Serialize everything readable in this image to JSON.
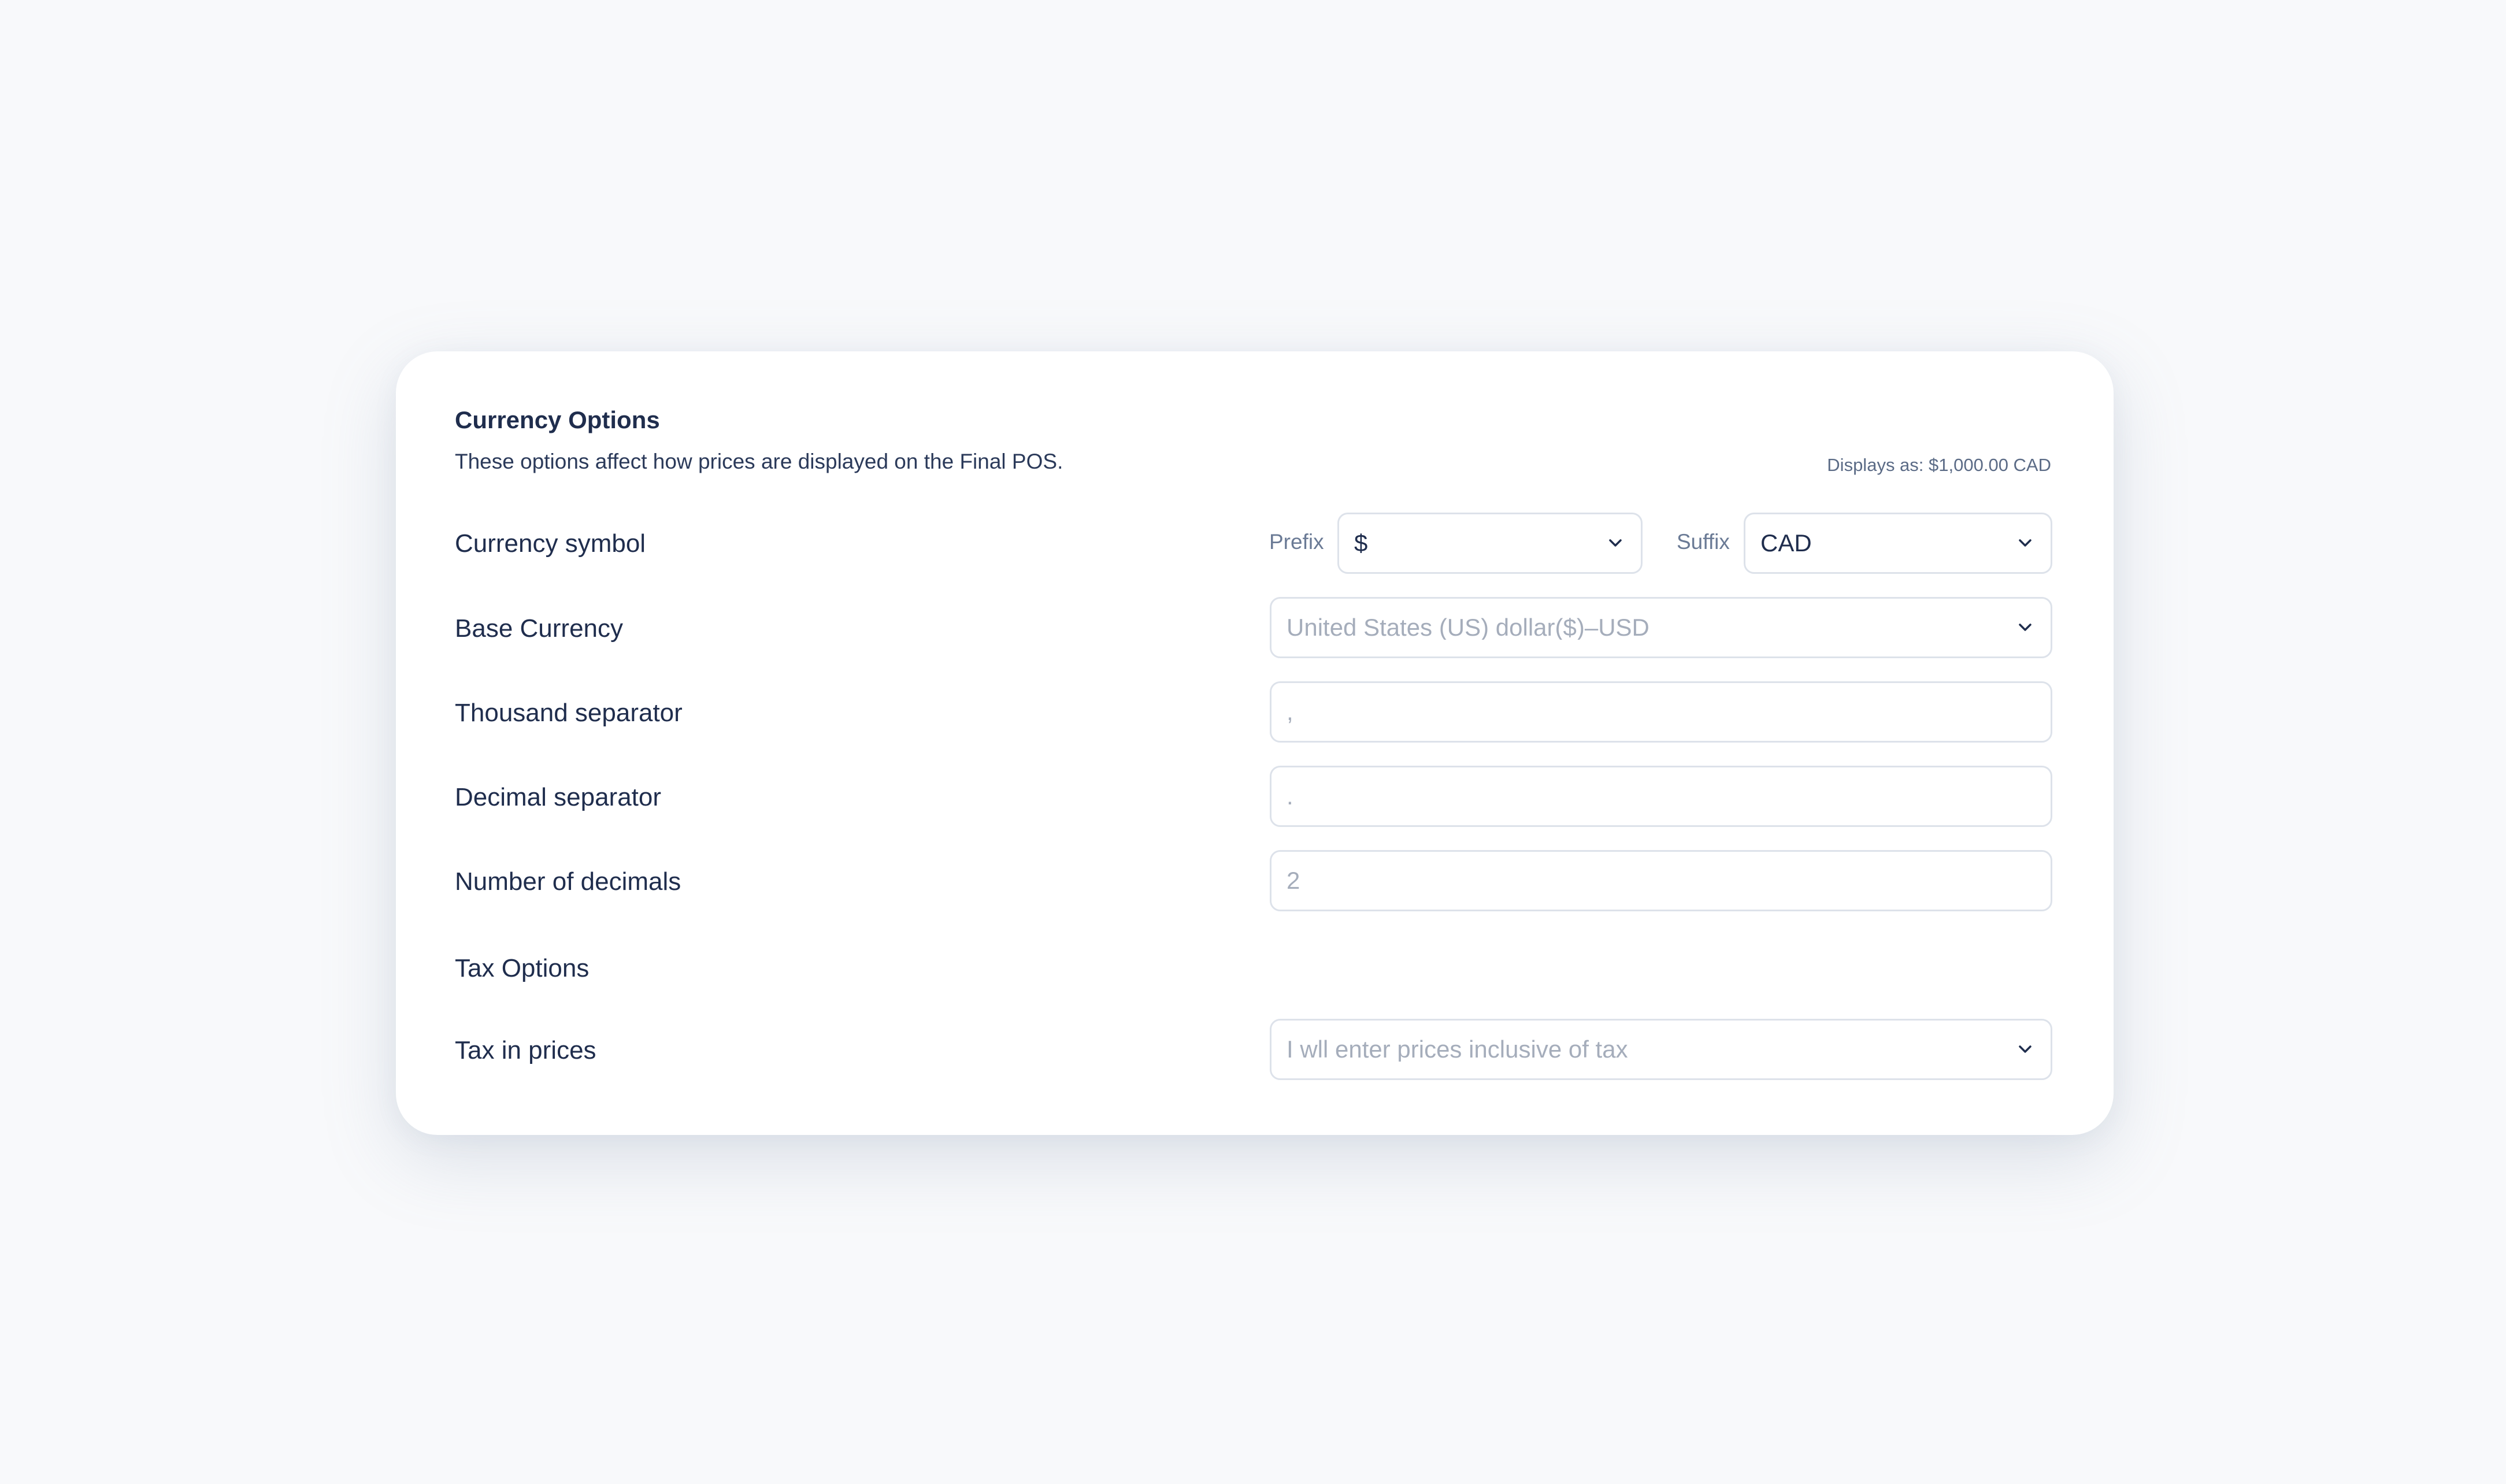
{
  "card": {
    "title": "Currency Options",
    "description": "These options affect how prices are displayed on the Final POS.",
    "display_note": "Displays as: $1,000.00 CAD"
  },
  "currency_symbol": {
    "label": "Currency symbol",
    "prefix_label": "Prefix",
    "prefix_value": "$",
    "suffix_label": "Suffix",
    "suffix_value": "CAD"
  },
  "base_currency": {
    "label": "Base Currency",
    "value": "United States (US) dollar($)–USD"
  },
  "thousand_separator": {
    "label": "Thousand separator",
    "value": ","
  },
  "decimal_separator": {
    "label": "Decimal separator",
    "value": "."
  },
  "number_of_decimals": {
    "label": "Number of decimals",
    "value": "2"
  },
  "tax_options": {
    "heading": "Tax Options"
  },
  "tax_in_prices": {
    "label": "Tax in prices",
    "value": "I wll enter prices inclusive of tax"
  },
  "icons": {
    "dropdown": "chevron-down-icon"
  },
  "colors": {
    "background": "#f8f9fb",
    "card": "#ffffff",
    "text_primary": "#1f2d4d",
    "text_muted": "#a5adbb",
    "border": "#dde2ea"
  }
}
